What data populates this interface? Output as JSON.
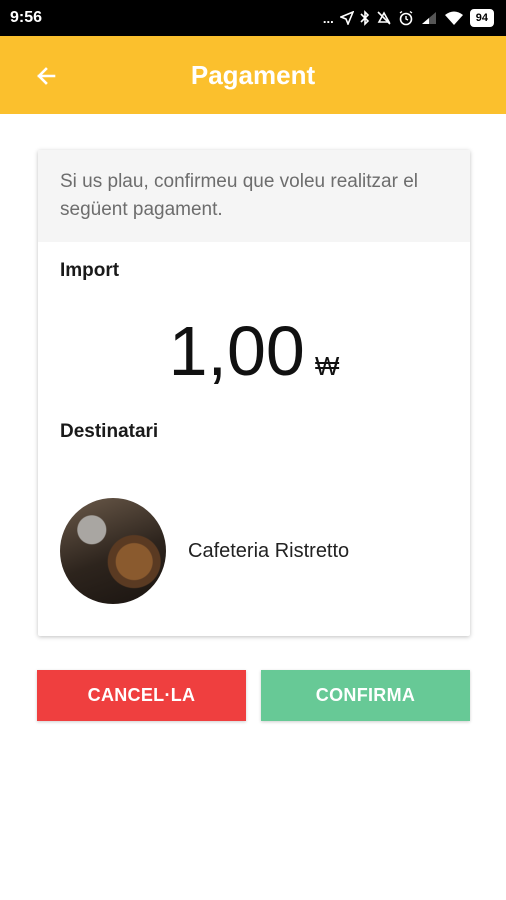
{
  "status_bar": {
    "time": "9:56",
    "dots": "...",
    "battery": "94"
  },
  "app_bar": {
    "title": "Pagament"
  },
  "card": {
    "message": "Si us plau, confirmeu que voleu realitzar el següent pagament.",
    "amount_label": "Import",
    "amount_value": "1,00",
    "currency_symbol": "₩",
    "recipient_label": "Destinatari",
    "recipient_name": "Cafeteria Ristretto"
  },
  "actions": {
    "cancel_label": "CANCEL·LA",
    "confirm_label": "CONFIRMA"
  },
  "colors": {
    "app_bar": "#FBC02D",
    "cancel": "#EF3F3F",
    "confirm": "#67C996"
  }
}
